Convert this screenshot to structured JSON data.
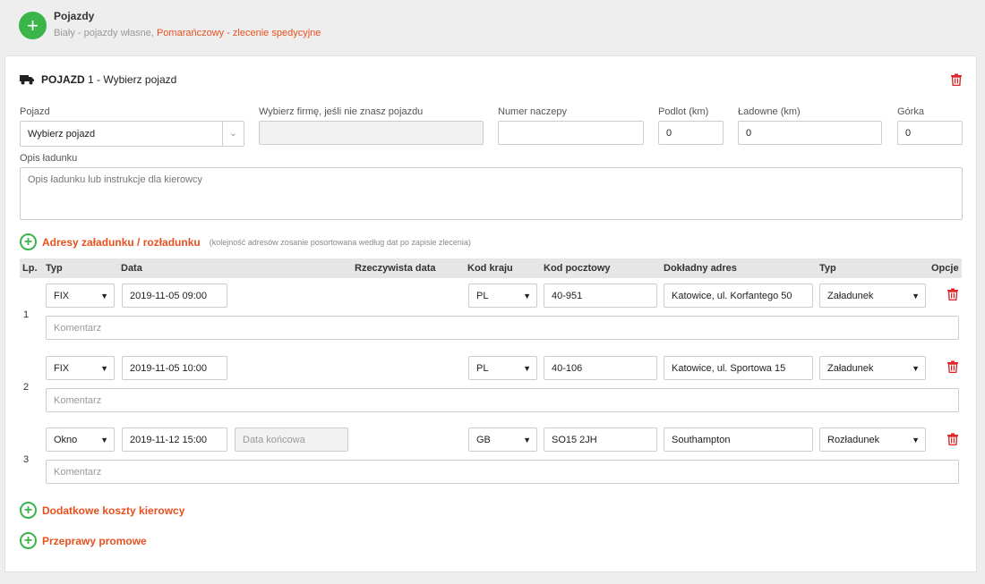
{
  "header": {
    "title": "Pojazdy",
    "subtitle_plain": "Biały - pojazdy własne, ",
    "subtitle_orange": "Pomarańczowy - zlecenie spedycyjne"
  },
  "vehicle": {
    "label_bold": "POJAZD",
    "label_rest": " 1 - Wybierz pojazd",
    "fields": {
      "pojazd_label": "Pojazd",
      "pojazd_value": "Wybierz pojazd",
      "firma_label": "Wybierz firmę, jeśli nie znasz pojazdu",
      "firma_value": "",
      "naczepa_label": "Numer naczepy",
      "naczepa_value": "",
      "podlot_label": "Podlot (km)",
      "podlot_value": "0",
      "ladowne_label": "Ładowne (km)",
      "ladowne_value": "0",
      "gorka_label": "Górka",
      "gorka_value": "0",
      "opis_label": "Opis ładunku",
      "opis_placeholder": "Opis ładunku lub instrukcje dla kierowcy"
    }
  },
  "addresses": {
    "link": "Adresy załadunku / rozładunku",
    "note": "(kolejność adresów zosanie posortowana według dat po zapisie zlecenia)",
    "columns": {
      "lp": "Lp.",
      "typ": "Typ",
      "data": "Data",
      "rzecz": "Rzeczywista data",
      "kraj": "Kod kraju",
      "pocztowy": "Kod pocztowy",
      "adres": "Dokładny adres",
      "typ2": "Typ",
      "opcje": "Opcje"
    },
    "comment_placeholder": "Komentarz",
    "end_date_placeholder": "Data końcowa",
    "rows": [
      {
        "lp": "1",
        "typ": "FIX",
        "data": "2019-11-05 09:00",
        "kraj": "PL",
        "pocztowy": "40-951",
        "adres": "Katowice, ul. Korfantego 50",
        "rodzaj": "Załadunek"
      },
      {
        "lp": "2",
        "typ": "FIX",
        "data": "2019-11-05 10:00",
        "kraj": "PL",
        "pocztowy": "40-106",
        "adres": "Katowice, ul. Sportowa 15",
        "rodzaj": "Załadunek"
      },
      {
        "lp": "3",
        "typ": "Okno",
        "data": "2019-11-12 15:00",
        "kraj": "GB",
        "pocztowy": "SO15 2JH",
        "adres": "Southampton",
        "rodzaj": "Rozładunek"
      }
    ]
  },
  "links": {
    "extra_costs": "Dodatkowe koszty kierowcy",
    "ferries": "Przeprawy promowe"
  },
  "colors": {
    "accent_green": "#39b54a",
    "accent_orange": "#e8501f",
    "danger_red": "#e0262a"
  }
}
